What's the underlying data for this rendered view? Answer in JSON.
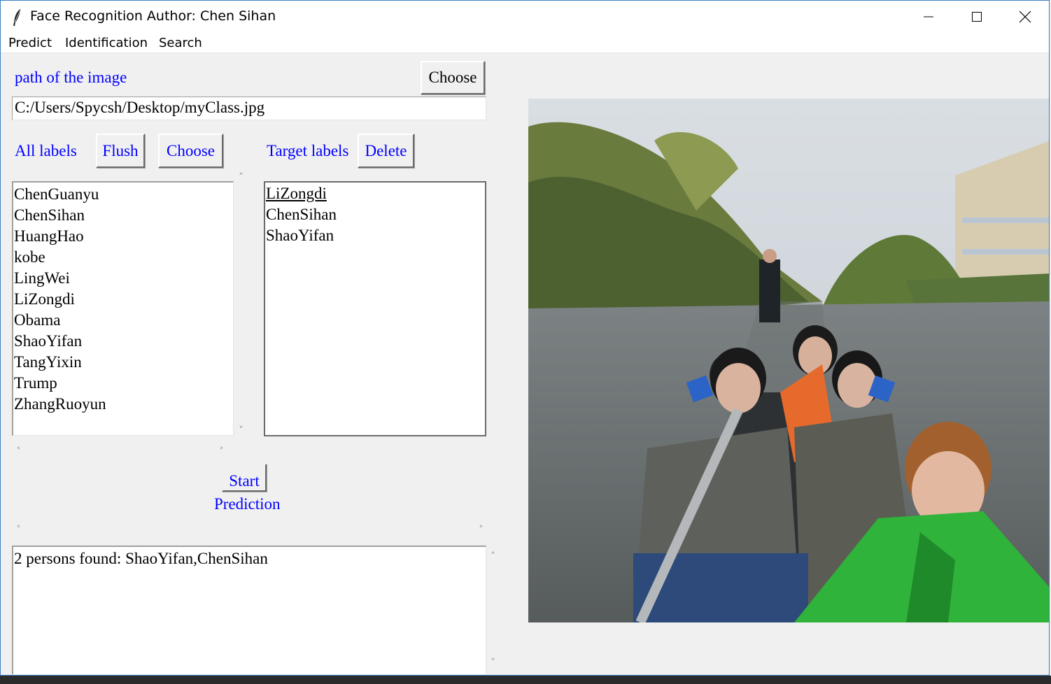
{
  "window": {
    "title": "Face Recognition Author: Chen Sihan",
    "title_icon": "feather-icon"
  },
  "menubar": {
    "items": [
      "Predict",
      "Identification",
      "Search"
    ]
  },
  "path_section": {
    "label": "path of the image",
    "choose_label": "Choose",
    "path_value": "C:/Users/Spycsh/Desktop/myClass.jpg"
  },
  "labels_section": {
    "all_labels_title": "All labels",
    "flush_label": "Flush",
    "choose_label": "Choose",
    "target_labels_title": "Target labels",
    "delete_label": "Delete",
    "all_labels": [
      "ChenGuanyu",
      "ChenSihan",
      "HuangHao",
      "kobe",
      "LingWei",
      "LiZongdi",
      "Obama",
      "ShaoYifan",
      "TangYixin",
      "Trump",
      "ZhangRuoyun"
    ],
    "target_labels": [
      "LiZongdi",
      "ChenSihan",
      "ShaoYifan"
    ],
    "active_target": "LiZongdi"
  },
  "prediction": {
    "start_label": "Start",
    "prediction_label": "Prediction",
    "result_text": "2 persons found: ShaoYifan,ChenSihan"
  },
  "colors": {
    "accent_blue": "#0000ff",
    "window_bg": "#f0f0f0",
    "taskbar": "#2b2b2b"
  }
}
